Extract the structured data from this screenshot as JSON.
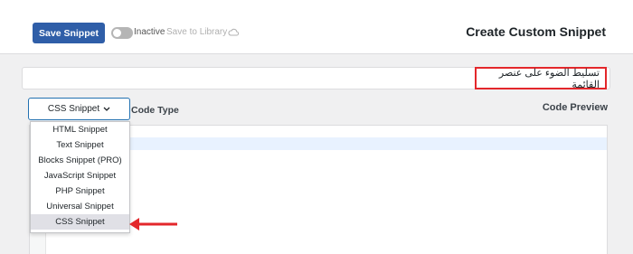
{
  "header": {
    "save_label": "Save Snippet",
    "status_label": "Inactive",
    "save_library_label": "Save to Library",
    "page_title": "Create Custom Snippet"
  },
  "snippet": {
    "title_value": "تسليط الضوء على عنصر القائمة"
  },
  "code_type": {
    "selected": "CSS Snippet",
    "label": "Code Type",
    "options": [
      "HTML Snippet",
      "Text Snippet",
      "Blocks Snippet (PRO)",
      "JavaScript Snippet",
      "PHP Snippet",
      "Universal Snippet",
      "CSS Snippet"
    ]
  },
  "preview": {
    "label": "Code Preview"
  },
  "colors": {
    "primary": "#2f5ea8",
    "highlight_border": "#e3272b",
    "arrow": "#e3272b"
  }
}
